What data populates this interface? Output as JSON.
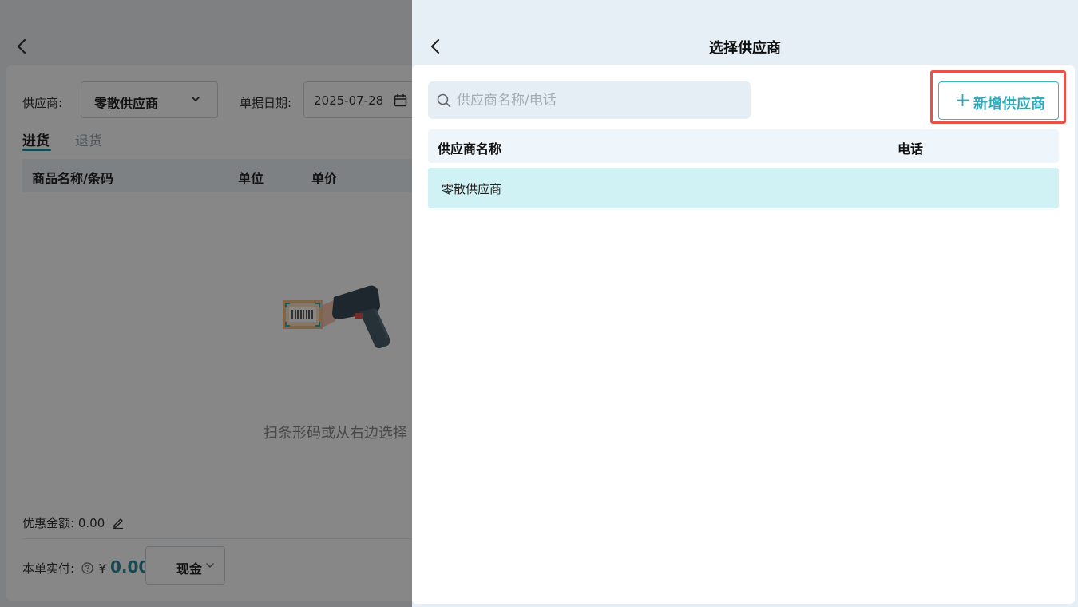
{
  "left_page": {
    "supplier_label": "供应商:",
    "supplier_value": "零散供应商",
    "date_label": "单据日期:",
    "date_value": "2025-07-28",
    "tabs": [
      {
        "label": "进货",
        "active": true
      },
      {
        "label": "退货",
        "active": false
      }
    ],
    "columns": [
      "商品名称/条码",
      "单位",
      "单价"
    ],
    "empty_text": "扫条形码或从右边选择",
    "discount_label": "优惠金额:",
    "discount_value": "0.00",
    "paid_label": "本单实付:",
    "currency": "¥",
    "paid_value": "0.00",
    "payment_method": "现金"
  },
  "drawer": {
    "title": "选择供应商",
    "search_placeholder": "供应商名称/电话",
    "search_value": "",
    "add_button_label": "新增供应商",
    "columns": {
      "name": "供应商名称",
      "phone": "电话"
    },
    "rows": [
      {
        "name": "零散供应商",
        "phone": ""
      }
    ]
  },
  "colors": {
    "accent": "#2fa8ba",
    "highlight_border": "#e5534b",
    "selected_row": "#d1f2f5",
    "overlay": "rgba(0,0,0,0.47)"
  },
  "icons": [
    "back-arrow-icon",
    "chevron-down-icon",
    "calendar-icon",
    "search-icon",
    "plus-icon",
    "barcode-scanner-illustration",
    "edit-icon",
    "help-circle-icon"
  ]
}
